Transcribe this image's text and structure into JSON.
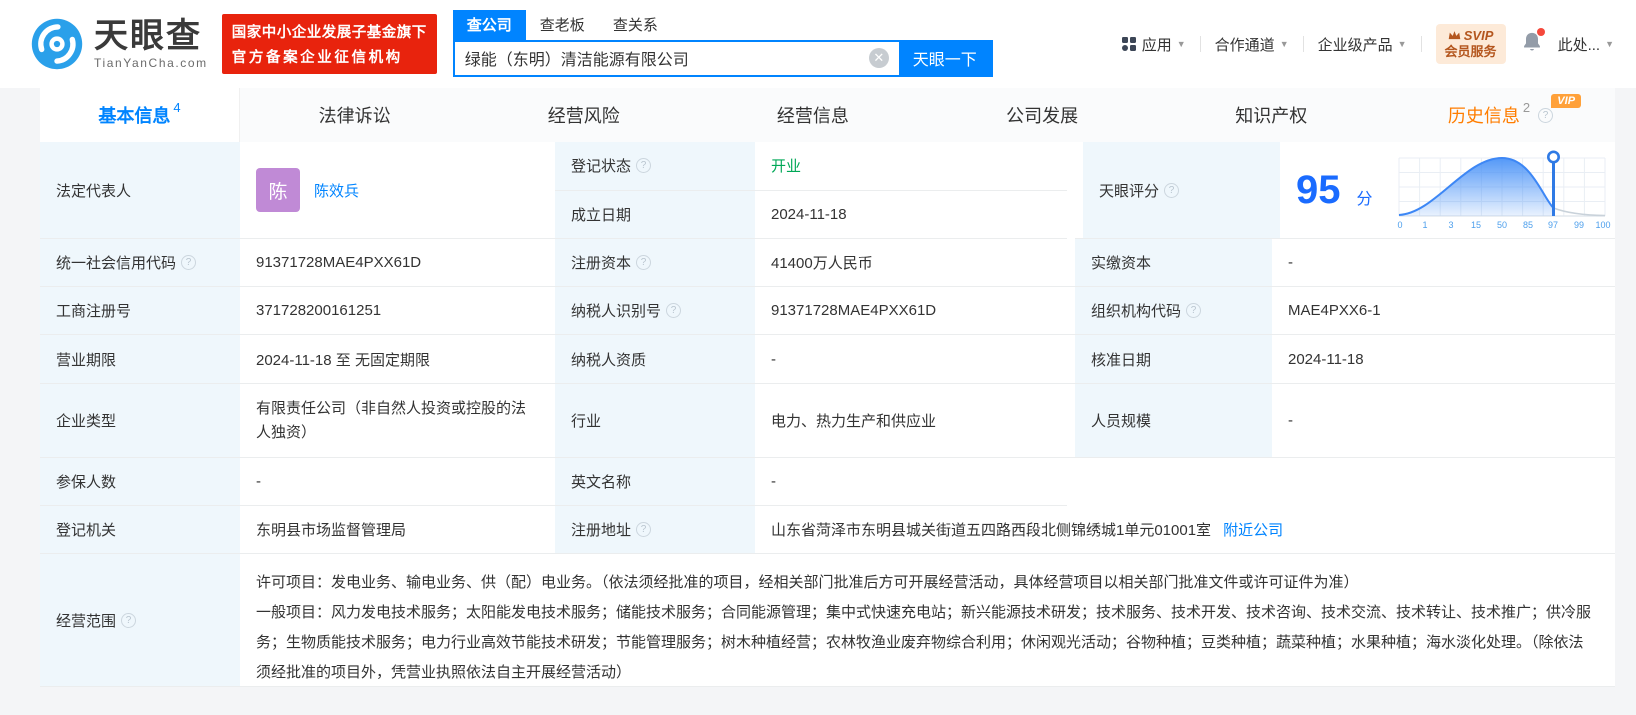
{
  "header": {
    "logo": {
      "brand": "天眼查",
      "domain": "TianYanCha.com"
    },
    "gov_badge": {
      "line1": "国家中小企业发展子基金旗下",
      "line2": "官方备案企业征信机构"
    },
    "search": {
      "tabs": [
        {
          "label": "查公司"
        },
        {
          "label": "查老板"
        },
        {
          "label": "查关系"
        }
      ],
      "value": "绿能（东明）清洁能源有限公司",
      "button": "天眼一下"
    },
    "nav": {
      "apps": "应用",
      "channel": "合作通道",
      "enterprise": "企业级产品",
      "svip_line1": "SVIP",
      "svip_line2": "会员服务",
      "user": "此处..."
    }
  },
  "tabs": [
    {
      "label": "基本信息",
      "count": "4"
    },
    {
      "label": "法律诉讼"
    },
    {
      "label": "经营风险"
    },
    {
      "label": "经营信息"
    },
    {
      "label": "公司发展"
    },
    {
      "label": "知识产权"
    },
    {
      "label": "历史信息",
      "count": "2",
      "vip": "VIP"
    }
  ],
  "company": {
    "legal_rep": {
      "label": "法定代表人",
      "avatar_char": "陈",
      "name": "陈效兵"
    },
    "reg_status": {
      "label": "登记状态",
      "value": "开业"
    },
    "est_date": {
      "label": "成立日期",
      "value": "2024-11-18"
    },
    "uscc": {
      "label": "统一社会信用代码",
      "value": "91371728MAE4PXX61D"
    },
    "reg_capital": {
      "label": "注册资本",
      "value": "41400万人民币"
    },
    "paid_capital": {
      "label": "实缴资本",
      "value": "-"
    },
    "reg_number": {
      "label": "工商注册号",
      "value": "371728200161251"
    },
    "taxpayer_id": {
      "label": "纳税人识别号",
      "value": "91371728MAE4PXX61D"
    },
    "org_code": {
      "label": "组织机构代码",
      "value": "MAE4PXX6-1"
    },
    "term": {
      "label": "营业期限",
      "value": "2024-11-18 至 无固定期限"
    },
    "taxpayer_quality": {
      "label": "纳税人资质",
      "value": "-"
    },
    "approval_date": {
      "label": "核准日期",
      "value": "2024-11-18"
    },
    "company_type": {
      "label": "企业类型",
      "value": "有限责任公司（非自然人投资或控股的法人独资）"
    },
    "industry": {
      "label": "行业",
      "value": "电力、热力生产和供应业"
    },
    "staff_size": {
      "label": "人员规模",
      "value": "-"
    },
    "insured": {
      "label": "参保人数",
      "value": "-"
    },
    "english_name": {
      "label": "英文名称",
      "value": "-"
    },
    "reg_authority": {
      "label": "登记机关",
      "value": "东明县市场监督管理局"
    },
    "address": {
      "label": "注册地址",
      "value": "山东省菏泽市东明县城关街道五四路西段北侧锦绣城1单元01001室",
      "nearby": "附近公司"
    },
    "scope": {
      "label": "经营范围",
      "value": "许可项目：发电业务、输电业务、供（配）电业务。（依法须经批准的项目，经相关部门批准后方可开展经营活动，具体经营项目以相关部门批准文件或许可证件为准）\n一般项目：风力发电技术服务；太阳能发电技术服务；储能技术服务；合同能源管理；集中式快速充电站；新兴能源技术研发；技术服务、技术开发、技术咨询、技术交流、技术转让、技术推广；供冷服务；生物质能技术服务；电力行业高效节能技术研发；节能管理服务；树木种植经营；农林牧渔业废弃物综合利用；休闲观光活动；谷物种植；豆类种植；蔬菜种植；水果种植；海水淡化处理。（除依法须经批准的项目外，凭营业执照依法自主开展经营活动）"
    }
  },
  "score": {
    "label": "天眼评分",
    "value": "95",
    "unit": "分",
    "chart": {
      "type": "area",
      "ticks": [
        "0",
        "1",
        "3",
        "15",
        "50",
        "85",
        "97",
        "99",
        "100"
      ],
      "marker": "97",
      "accent": "#3d87f5"
    }
  }
}
